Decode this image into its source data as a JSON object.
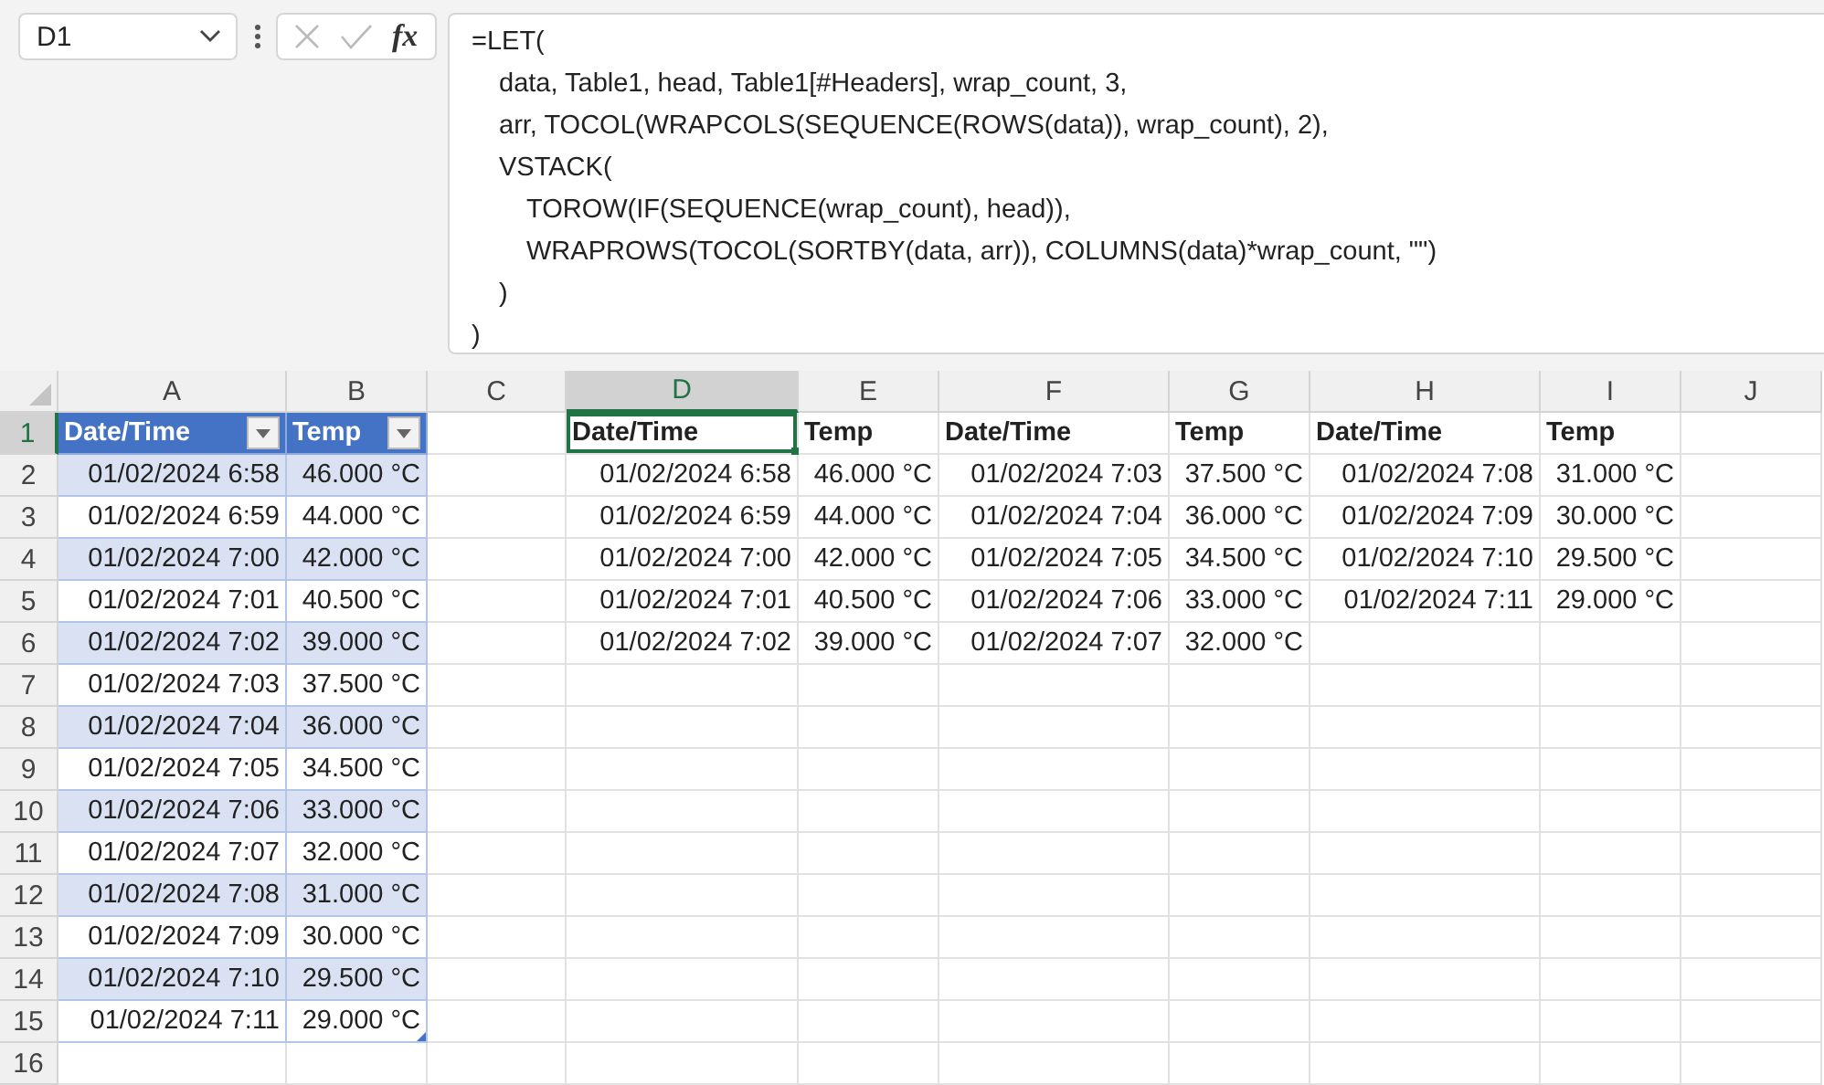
{
  "name_box": {
    "value": "D1"
  },
  "formula_buttons": {
    "function_label": "fx"
  },
  "formula": [
    {
      "text": "=LET(",
      "children": [
        {
          "text": "data, Table1, head, Table1[#Headers], wrap_count, 3,"
        },
        {
          "text": "arr, TOCOL(WRAPCOLS(SEQUENCE(ROWS(data)), wrap_count), 2),"
        },
        {
          "text": "VSTACK(",
          "children": [
            {
              "text": "TOROW(IF(SEQUENCE(wrap_count), head)),"
            },
            {
              "text": "WRAPROWS(TOCOL(SORTBY(data, arr)), COLUMNS(data)*wrap_count, \"\")"
            }
          ]
        },
        {
          "text": ")"
        }
      ]
    },
    {
      "text": ")"
    }
  ],
  "columns": [
    {
      "label": "A",
      "selected": false
    },
    {
      "label": "B",
      "selected": false
    },
    {
      "label": "C",
      "selected": false
    },
    {
      "label": "D",
      "selected": true
    },
    {
      "label": "E",
      "selected": false
    },
    {
      "label": "F",
      "selected": false
    },
    {
      "label": "G",
      "selected": false
    },
    {
      "label": "H",
      "selected": false
    },
    {
      "label": "I",
      "selected": false
    },
    {
      "label": "J",
      "selected": false
    }
  ],
  "rows": [
    {
      "label": "1",
      "selected": true
    },
    {
      "label": "2",
      "selected": false
    },
    {
      "label": "3",
      "selected": false
    },
    {
      "label": "4",
      "selected": false
    },
    {
      "label": "5",
      "selected": false
    },
    {
      "label": "6",
      "selected": false
    },
    {
      "label": "7",
      "selected": false
    },
    {
      "label": "8",
      "selected": false
    },
    {
      "label": "9",
      "selected": false
    },
    {
      "label": "10",
      "selected": false
    },
    {
      "label": "11",
      "selected": false
    },
    {
      "label": "12",
      "selected": false
    },
    {
      "label": "13",
      "selected": false
    },
    {
      "label": "14",
      "selected": false
    },
    {
      "label": "15",
      "selected": false
    },
    {
      "label": "16",
      "selected": false
    }
  ],
  "table1": {
    "columns": [
      {
        "label": "Date/Time"
      },
      {
        "label": "Temp"
      }
    ],
    "rows": [
      {
        "cells": [
          "01/02/2024 6:58",
          "46.000 °C"
        ]
      },
      {
        "cells": [
          "01/02/2024 6:59",
          "44.000 °C"
        ]
      },
      {
        "cells": [
          "01/02/2024 7:00",
          "42.000 °C"
        ]
      },
      {
        "cells": [
          "01/02/2024 7:01",
          "40.500 °C"
        ]
      },
      {
        "cells": [
          "01/02/2024 7:02",
          "39.000 °C"
        ]
      },
      {
        "cells": [
          "01/02/2024 7:03",
          "37.500 °C"
        ]
      },
      {
        "cells": [
          "01/02/2024 7:04",
          "36.000 °C"
        ]
      },
      {
        "cells": [
          "01/02/2024 7:05",
          "34.500 °C"
        ]
      },
      {
        "cells": [
          "01/02/2024 7:06",
          "33.000 °C"
        ]
      },
      {
        "cells": [
          "01/02/2024 7:07",
          "32.000 °C"
        ]
      },
      {
        "cells": [
          "01/02/2024 7:08",
          "31.000 °C"
        ]
      },
      {
        "cells": [
          "01/02/2024 7:09",
          "30.000 °C"
        ]
      },
      {
        "cells": [
          "01/02/2024 7:10",
          "29.500 °C"
        ]
      },
      {
        "cells": [
          "01/02/2024 7:11",
          "29.000 °C"
        ]
      }
    ]
  },
  "spill": {
    "header": [
      {
        "label": "Date/Time",
        "active": true
      },
      {
        "label": "Temp",
        "active": false
      },
      {
        "label": "Date/Time",
        "active": false
      },
      {
        "label": "Temp",
        "active": false
      },
      {
        "label": "Date/Time",
        "active": false
      },
      {
        "label": "Temp",
        "active": false
      }
    ],
    "rows": [
      {
        "cells": [
          "01/02/2024 6:58",
          "46.000 °C",
          "01/02/2024 7:03",
          "37.500 °C",
          "01/02/2024 7:08",
          "31.000 °C"
        ]
      },
      {
        "cells": [
          "01/02/2024 6:59",
          "44.000 °C",
          "01/02/2024 7:04",
          "36.000 °C",
          "01/02/2024 7:09",
          "30.000 °C"
        ]
      },
      {
        "cells": [
          "01/02/2024 7:00",
          "42.000 °C",
          "01/02/2024 7:05",
          "34.500 °C",
          "01/02/2024 7:10",
          "29.500 °C"
        ]
      },
      {
        "cells": [
          "01/02/2024 7:01",
          "40.500 °C",
          "01/02/2024 7:06",
          "33.000 °C",
          "01/02/2024 7:11",
          "29.000 °C"
        ]
      },
      {
        "cells": [
          "01/02/2024 7:02",
          "39.000 °C",
          "01/02/2024 7:07",
          "32.000 °C"
        ]
      }
    ]
  }
}
